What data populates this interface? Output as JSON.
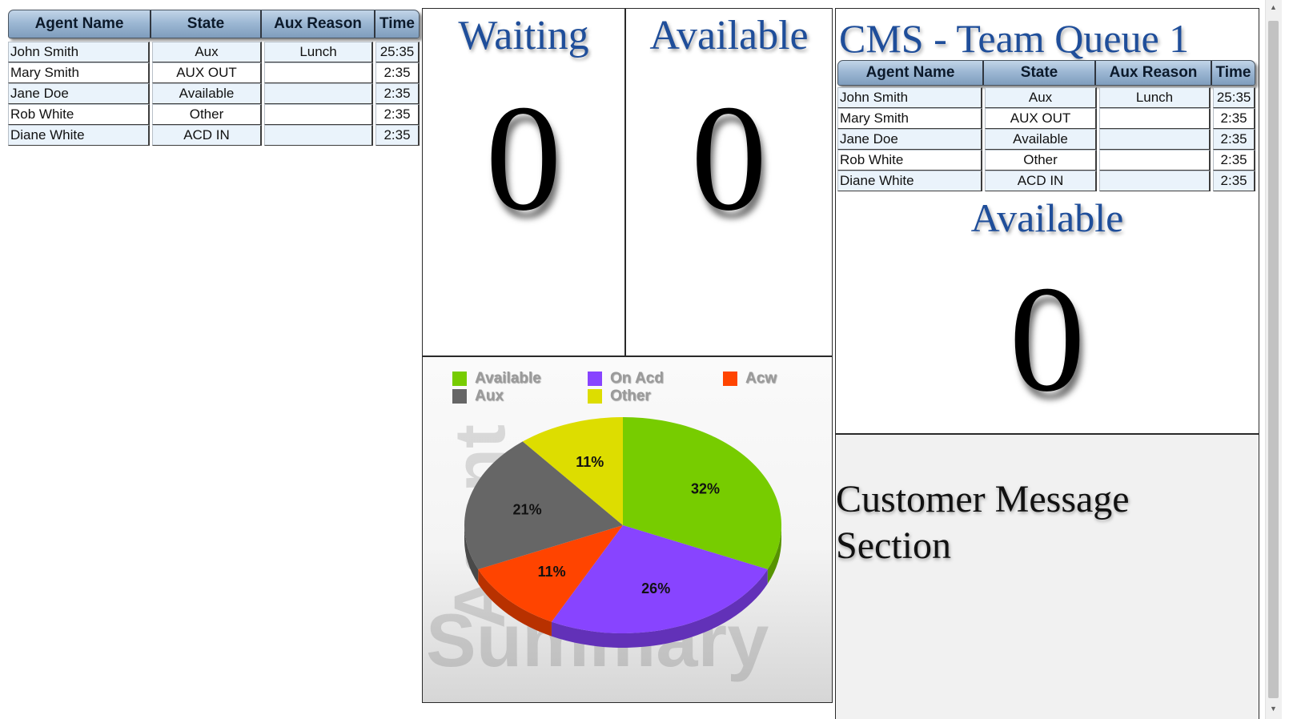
{
  "agent_table_headers": [
    "Agent Name",
    "State",
    "Aux Reason",
    "Time"
  ],
  "agents": [
    {
      "name": "John Smith",
      "state": "Aux",
      "aux_reason": "Lunch",
      "time": "25:35"
    },
    {
      "name": "Mary Smith",
      "state": "AUX OUT",
      "aux_reason": "",
      "time": "2:35"
    },
    {
      "name": "Jane Doe",
      "state": "Available",
      "aux_reason": "",
      "time": "2:35"
    },
    {
      "name": "Rob White",
      "state": "Other",
      "aux_reason": "",
      "time": "2:35"
    },
    {
      "name": "Diane White",
      "state": "ACD IN",
      "aux_reason": "",
      "time": "2:35"
    }
  ],
  "waiting": {
    "label": "Waiting",
    "value": "0"
  },
  "available": {
    "label": "Available",
    "value": "0"
  },
  "cms": {
    "title": "CMS - Team Queue 1",
    "available_label": "Available",
    "available_value": "0"
  },
  "message": {
    "text": "Customer Message Section"
  },
  "chart_data": {
    "type": "pie",
    "title": "",
    "watermark": "Agent Summary",
    "legend": [
      "Available",
      "On Acd",
      "Acw",
      "Aux",
      "Other"
    ],
    "legend_position": "top",
    "slices": [
      {
        "name": "Available",
        "value": 32,
        "label": "32%",
        "color": "#77cc00"
      },
      {
        "name": "On Acd",
        "value": 26,
        "label": "26%",
        "color": "#8844ff"
      },
      {
        "name": "Acw",
        "value": 11,
        "label": "11%",
        "color": "#ff4400"
      },
      {
        "name": "Aux",
        "value": 21,
        "label": "21%",
        "color": "#666666"
      },
      {
        "name": "Other",
        "value": 11,
        "label": "11%",
        "color": "#dddd00"
      }
    ]
  }
}
